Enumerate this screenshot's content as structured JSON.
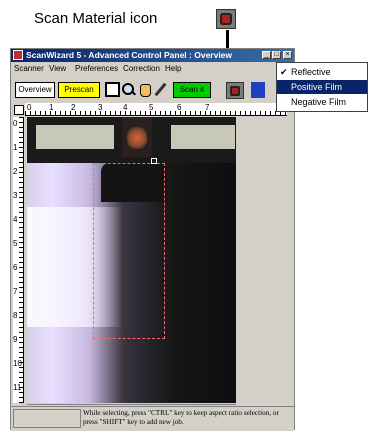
{
  "annotation": {
    "label": "Scan Material icon",
    "icon": "scan-material-icon"
  },
  "window": {
    "title": "ScanWizard 5 - Advanced Control Panel : Overview",
    "min_label": "_",
    "max_label": "□",
    "close_label": "×"
  },
  "menubar": {
    "items": [
      {
        "label": "Scanner"
      },
      {
        "label": "View"
      },
      {
        "label": "Preferences"
      },
      {
        "label": "Correction"
      },
      {
        "label": "Help"
      }
    ]
  },
  "toolbar": {
    "overview_label": "Overview",
    "prescan_label": "Prescan",
    "scan_label": "Scan it",
    "icons": [
      "selection-frame-icon",
      "zoom-icon",
      "hand-icon",
      "eyedropper-icon",
      "scan-material-icon"
    ]
  },
  "ruler": {
    "h_ticks": [
      "0",
      "1",
      "2",
      "3",
      "4",
      "5",
      "6",
      "7"
    ],
    "v_ticks": [
      "0",
      "1",
      "2",
      "3",
      "4",
      "5",
      "6",
      "7",
      "8",
      "9",
      "10",
      "11"
    ]
  },
  "status": {
    "hint": "While selecting, press \"CTRL\" key to keep aspect ratio selection, or press \"SHIFT\" key to add new job."
  },
  "dropdown": {
    "items": [
      {
        "label": "Reflective",
        "checked": true,
        "highlighted": false
      },
      {
        "label": "Positive Film",
        "checked": false,
        "highlighted": true
      },
      {
        "label": "Negative Film",
        "checked": false,
        "highlighted": false
      }
    ]
  },
  "colors": {
    "titlebar": "#0a246a",
    "prescan_button": "#ffff00",
    "scan_button": "#00cc00",
    "highlight": "#0a246a",
    "selection_frame": "#ff6666"
  }
}
